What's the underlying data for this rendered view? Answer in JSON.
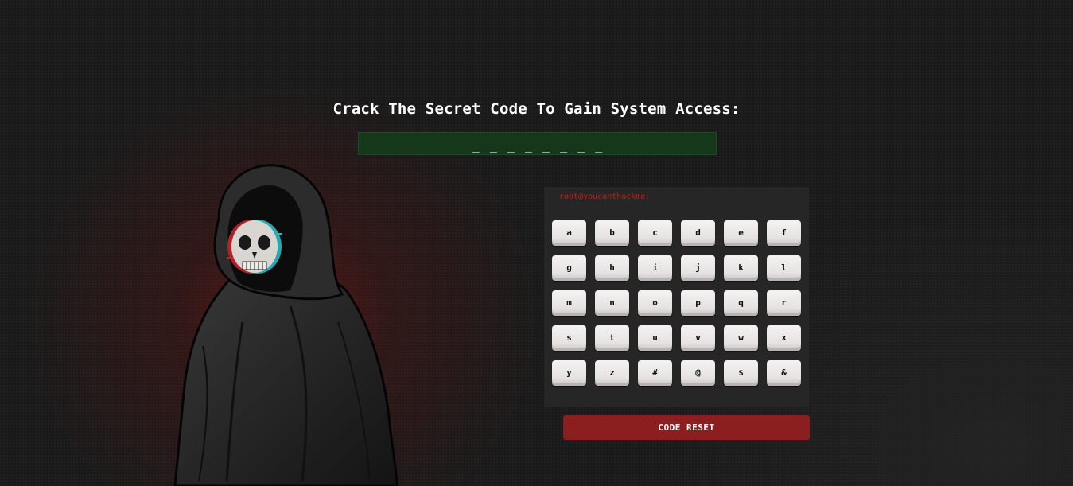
{
  "heading": "Crack The Secret Code To Gain System Access:",
  "code_display": "_ _ _ _ _ _ _ _",
  "terminal_prompt": "root@youcanthackme:",
  "keys": [
    "a",
    "b",
    "c",
    "d",
    "e",
    "f",
    "g",
    "h",
    "i",
    "j",
    "k",
    "l",
    "m",
    "n",
    "o",
    "p",
    "q",
    "r",
    "s",
    "t",
    "u",
    "v",
    "w",
    "x",
    "y",
    "z",
    "#",
    "@",
    "$",
    "&"
  ],
  "reset_label": "CODE RESET",
  "illustration": "hooded-skull-figure",
  "colors": {
    "background": "#1a1a1a",
    "display_green": "#15381a",
    "prompt_red": "#cc1a1a",
    "reset_red": "#8b1e1e",
    "key_face": "#e6e2e2"
  }
}
